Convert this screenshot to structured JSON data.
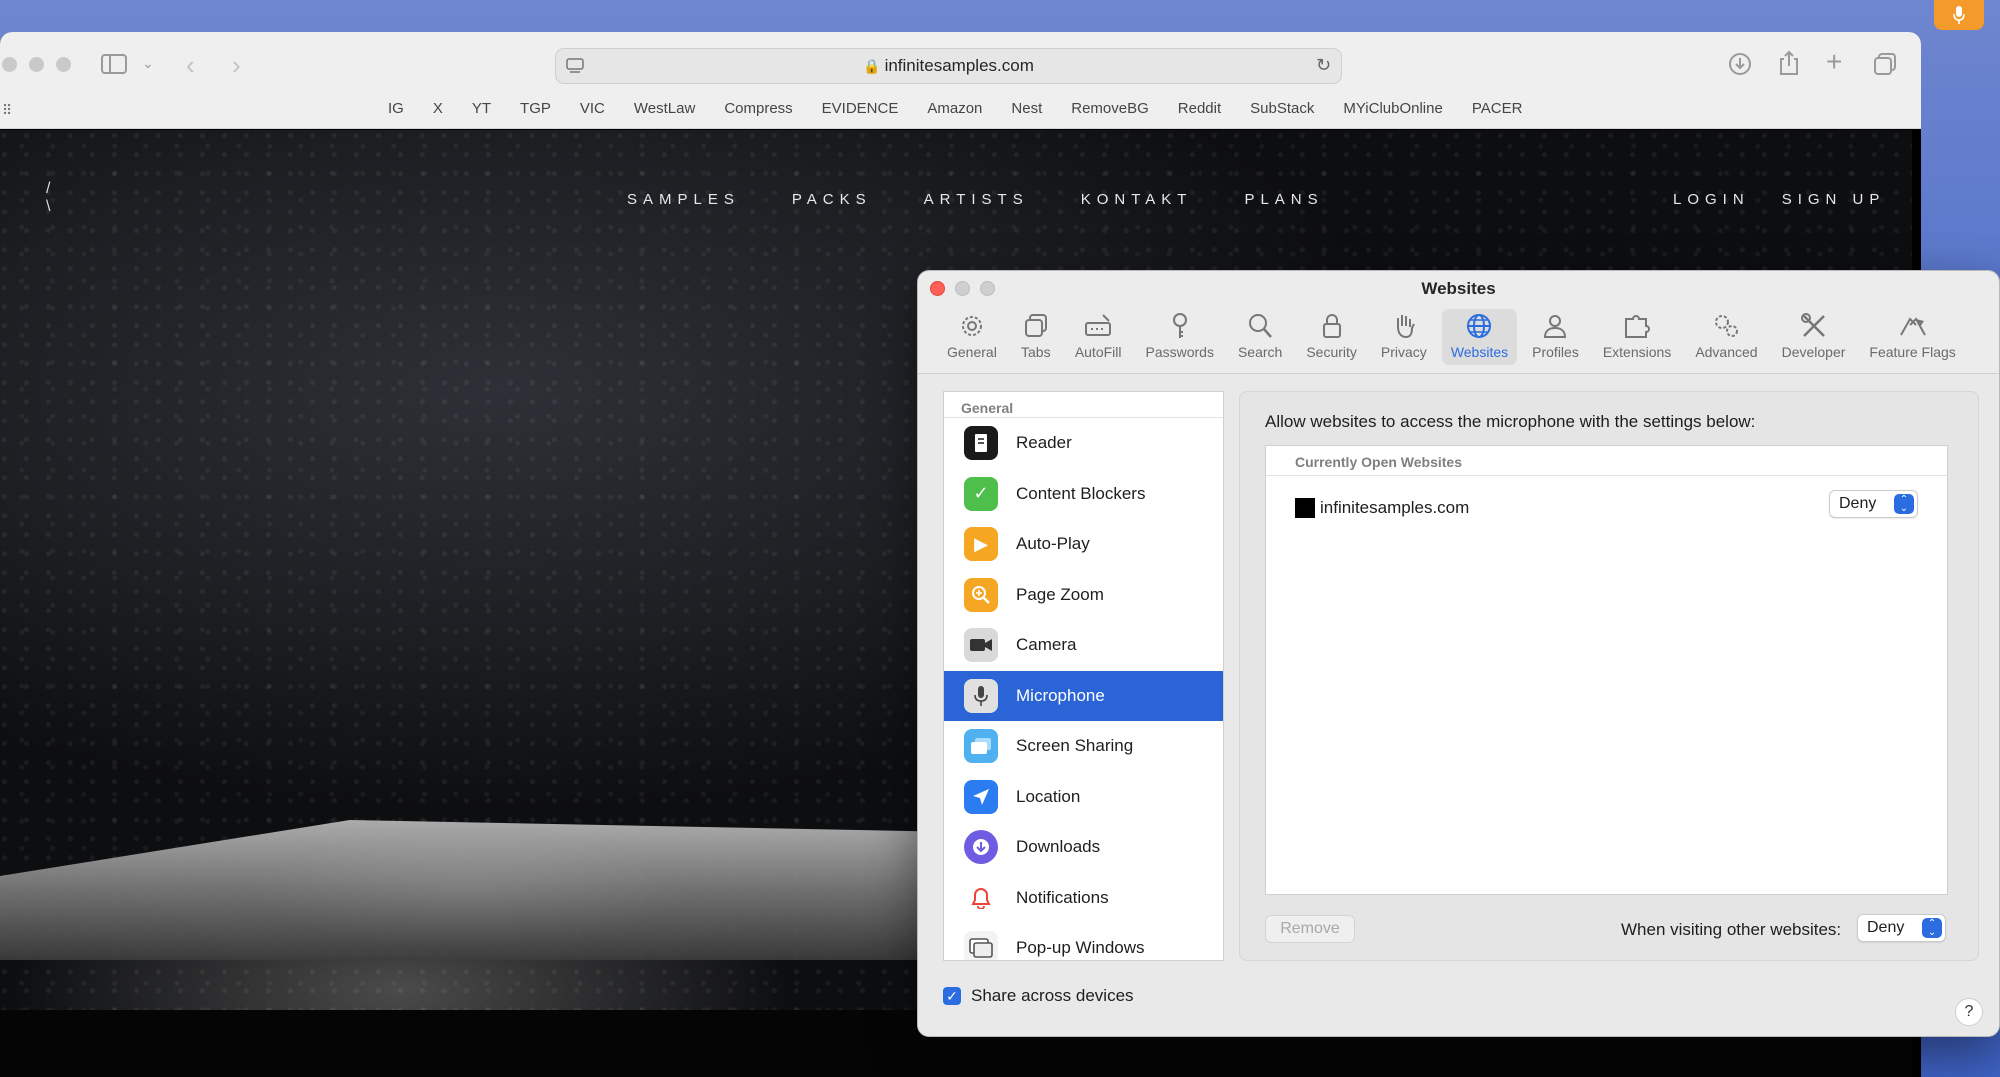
{
  "browser": {
    "url": "infinitesamples.com",
    "bookmarks": [
      "IG",
      "X",
      "YT",
      "TGP",
      "VIC",
      "WestLaw",
      "Compress",
      "EVIDENCE",
      "Amazon",
      "Nest",
      "RemoveBG",
      "Reddit",
      "SubStack",
      "MYiClubOnline",
      "PACER"
    ]
  },
  "site": {
    "nav": [
      "SAMPLES",
      "PACKS",
      "ARTISTS",
      "KONTAKT",
      "PLANS"
    ],
    "auth": [
      "LOGIN",
      "SIGN UP"
    ]
  },
  "prefs": {
    "title": "Websites",
    "tabs": [
      {
        "label": "General",
        "icon": "gear-icon"
      },
      {
        "label": "Tabs",
        "icon": "tabs-icon"
      },
      {
        "label": "AutoFill",
        "icon": "autofill-icon"
      },
      {
        "label": "Passwords",
        "icon": "key-icon"
      },
      {
        "label": "Search",
        "icon": "search-icon"
      },
      {
        "label": "Security",
        "icon": "lock-icon"
      },
      {
        "label": "Privacy",
        "icon": "hand-icon"
      },
      {
        "label": "Websites",
        "icon": "globe-icon"
      },
      {
        "label": "Profiles",
        "icon": "person-icon"
      },
      {
        "label": "Extensions",
        "icon": "puzzle-icon"
      },
      {
        "label": "Advanced",
        "icon": "gears-icon"
      },
      {
        "label": "Developer",
        "icon": "tools-icon"
      },
      {
        "label": "Feature Flags",
        "icon": "flags-icon"
      }
    ],
    "active_tab": "Websites",
    "sidebar": {
      "header": "General",
      "items": [
        {
          "label": "Reader",
          "icon": "reader-icon",
          "color": "#1a1a1a"
        },
        {
          "label": "Content Blockers",
          "icon": "shield-check-icon",
          "color": "#4fbf4b"
        },
        {
          "label": "Auto-Play",
          "icon": "play-icon",
          "color": "#f5a623"
        },
        {
          "label": "Page Zoom",
          "icon": "zoom-icon",
          "color": "#f5a623"
        },
        {
          "label": "Camera",
          "icon": "camera-icon",
          "color": "#5c5c5c"
        },
        {
          "label": "Microphone",
          "icon": "microphone-icon",
          "color": "#b8b8b8"
        },
        {
          "label": "Screen Sharing",
          "icon": "screen-icon",
          "color": "#4fb1f0"
        },
        {
          "label": "Location",
          "icon": "location-icon",
          "color": "#2b7cf1"
        },
        {
          "label": "Downloads",
          "icon": "download-icon",
          "color": "#6e5de2"
        },
        {
          "label": "Notifications",
          "icon": "bell-icon",
          "color": "#ffffff"
        },
        {
          "label": "Pop-up Windows",
          "icon": "popup-icon",
          "color": "#ffffff"
        }
      ],
      "selected": "Microphone"
    },
    "panel": {
      "description": "Allow websites to access the microphone with the settings below:",
      "table_header": "Currently Open Websites",
      "rows": [
        {
          "domain": "infinitesamples.com",
          "setting": "Deny"
        }
      ],
      "remove_label": "Remove",
      "other_label": "When visiting other websites:",
      "other_setting": "Deny"
    },
    "share_label": "Share across devices",
    "share_checked": true,
    "help_label": "?"
  }
}
